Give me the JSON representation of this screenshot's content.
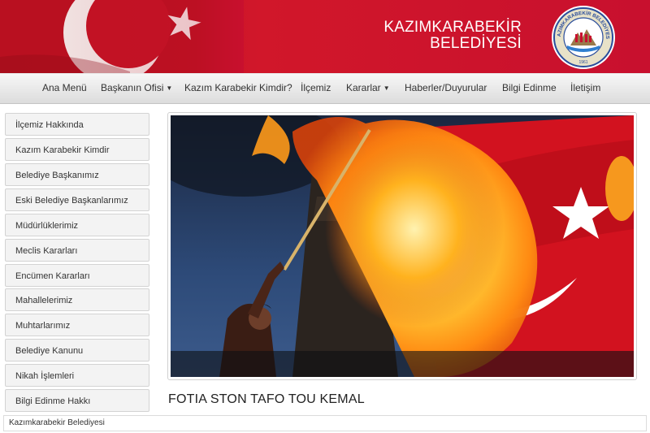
{
  "header": {
    "title_line1": "KAZIMKARABEKİR",
    "title_line2": "BELEDİYESİ",
    "seal_text": "KAZIMKARABEKİR BELEDİYESİ",
    "seal_year": "1961",
    "brand_color": "#c8102e"
  },
  "nav": {
    "items": [
      {
        "label": "Ana Menü",
        "has_dropdown": false
      },
      {
        "label": "Başkanın Ofisi",
        "has_dropdown": true
      },
      {
        "label": "Kazım Karabekir Kimdir?",
        "has_dropdown": false
      },
      {
        "label": "İlçemiz",
        "has_dropdown": false
      },
      {
        "label": "Kararlar",
        "has_dropdown": true
      },
      {
        "label": "Haberler/Duyurular",
        "has_dropdown": false
      },
      {
        "label": "Bilgi Edinme",
        "has_dropdown": false
      },
      {
        "label": "İletişim",
        "has_dropdown": false
      }
    ],
    "dropdown_icon": "caret-down-icon"
  },
  "sidebar": {
    "items": [
      {
        "label": "İlçemiz Hakkında"
      },
      {
        "label": "Kazım Karabekir Kimdir"
      },
      {
        "label": "Belediye Başkanımız"
      },
      {
        "label": "Eski Belediye Başkanlarımız"
      },
      {
        "label": "Müdürlüklerimiz"
      },
      {
        "label": "Meclis Kararları"
      },
      {
        "label": "Encümen Kararları"
      },
      {
        "label": "Mahallelerimiz"
      },
      {
        "label": "Muhtarlarımız"
      },
      {
        "label": "Belediye Kanunu"
      },
      {
        "label": "Nikah İşlemleri"
      },
      {
        "label": "Bilgi Edinme Hakkı"
      }
    ]
  },
  "main": {
    "article_title": "FOTIA STON TAFO TOU KEMAL"
  },
  "footer": {
    "text": "Kazımkarabekir Belediyesi"
  }
}
